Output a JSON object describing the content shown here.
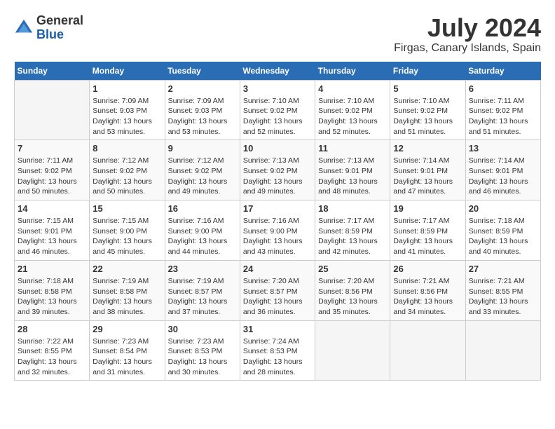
{
  "header": {
    "logo": {
      "general": "General",
      "blue": "Blue"
    },
    "title": "July 2024",
    "location": "Firgas, Canary Islands, Spain"
  },
  "calendar": {
    "days_of_week": [
      "Sunday",
      "Monday",
      "Tuesday",
      "Wednesday",
      "Thursday",
      "Friday",
      "Saturday"
    ],
    "weeks": [
      [
        {
          "day": "",
          "sunrise": "",
          "sunset": "",
          "daylight": ""
        },
        {
          "day": "1",
          "sunrise": "Sunrise: 7:09 AM",
          "sunset": "Sunset: 9:03 PM",
          "daylight": "Daylight: 13 hours and 53 minutes."
        },
        {
          "day": "2",
          "sunrise": "Sunrise: 7:09 AM",
          "sunset": "Sunset: 9:03 PM",
          "daylight": "Daylight: 13 hours and 53 minutes."
        },
        {
          "day": "3",
          "sunrise": "Sunrise: 7:10 AM",
          "sunset": "Sunset: 9:02 PM",
          "daylight": "Daylight: 13 hours and 52 minutes."
        },
        {
          "day": "4",
          "sunrise": "Sunrise: 7:10 AM",
          "sunset": "Sunset: 9:02 PM",
          "daylight": "Daylight: 13 hours and 52 minutes."
        },
        {
          "day": "5",
          "sunrise": "Sunrise: 7:10 AM",
          "sunset": "Sunset: 9:02 PM",
          "daylight": "Daylight: 13 hours and 51 minutes."
        },
        {
          "day": "6",
          "sunrise": "Sunrise: 7:11 AM",
          "sunset": "Sunset: 9:02 PM",
          "daylight": "Daylight: 13 hours and 51 minutes."
        }
      ],
      [
        {
          "day": "7",
          "sunrise": "Sunrise: 7:11 AM",
          "sunset": "Sunset: 9:02 PM",
          "daylight": "Daylight: 13 hours and 50 minutes."
        },
        {
          "day": "8",
          "sunrise": "Sunrise: 7:12 AM",
          "sunset": "Sunset: 9:02 PM",
          "daylight": "Daylight: 13 hours and 50 minutes."
        },
        {
          "day": "9",
          "sunrise": "Sunrise: 7:12 AM",
          "sunset": "Sunset: 9:02 PM",
          "daylight": "Daylight: 13 hours and 49 minutes."
        },
        {
          "day": "10",
          "sunrise": "Sunrise: 7:13 AM",
          "sunset": "Sunset: 9:02 PM",
          "daylight": "Daylight: 13 hours and 49 minutes."
        },
        {
          "day": "11",
          "sunrise": "Sunrise: 7:13 AM",
          "sunset": "Sunset: 9:01 PM",
          "daylight": "Daylight: 13 hours and 48 minutes."
        },
        {
          "day": "12",
          "sunrise": "Sunrise: 7:14 AM",
          "sunset": "Sunset: 9:01 PM",
          "daylight": "Daylight: 13 hours and 47 minutes."
        },
        {
          "day": "13",
          "sunrise": "Sunrise: 7:14 AM",
          "sunset": "Sunset: 9:01 PM",
          "daylight": "Daylight: 13 hours and 46 minutes."
        }
      ],
      [
        {
          "day": "14",
          "sunrise": "Sunrise: 7:15 AM",
          "sunset": "Sunset: 9:01 PM",
          "daylight": "Daylight: 13 hours and 46 minutes."
        },
        {
          "day": "15",
          "sunrise": "Sunrise: 7:15 AM",
          "sunset": "Sunset: 9:00 PM",
          "daylight": "Daylight: 13 hours and 45 minutes."
        },
        {
          "day": "16",
          "sunrise": "Sunrise: 7:16 AM",
          "sunset": "Sunset: 9:00 PM",
          "daylight": "Daylight: 13 hours and 44 minutes."
        },
        {
          "day": "17",
          "sunrise": "Sunrise: 7:16 AM",
          "sunset": "Sunset: 9:00 PM",
          "daylight": "Daylight: 13 hours and 43 minutes."
        },
        {
          "day": "18",
          "sunrise": "Sunrise: 7:17 AM",
          "sunset": "Sunset: 8:59 PM",
          "daylight": "Daylight: 13 hours and 42 minutes."
        },
        {
          "day": "19",
          "sunrise": "Sunrise: 7:17 AM",
          "sunset": "Sunset: 8:59 PM",
          "daylight": "Daylight: 13 hours and 41 minutes."
        },
        {
          "day": "20",
          "sunrise": "Sunrise: 7:18 AM",
          "sunset": "Sunset: 8:59 PM",
          "daylight": "Daylight: 13 hours and 40 minutes."
        }
      ],
      [
        {
          "day": "21",
          "sunrise": "Sunrise: 7:18 AM",
          "sunset": "Sunset: 8:58 PM",
          "daylight": "Daylight: 13 hours and 39 minutes."
        },
        {
          "day": "22",
          "sunrise": "Sunrise: 7:19 AM",
          "sunset": "Sunset: 8:58 PM",
          "daylight": "Daylight: 13 hours and 38 minutes."
        },
        {
          "day": "23",
          "sunrise": "Sunrise: 7:19 AM",
          "sunset": "Sunset: 8:57 PM",
          "daylight": "Daylight: 13 hours and 37 minutes."
        },
        {
          "day": "24",
          "sunrise": "Sunrise: 7:20 AM",
          "sunset": "Sunset: 8:57 PM",
          "daylight": "Daylight: 13 hours and 36 minutes."
        },
        {
          "day": "25",
          "sunrise": "Sunrise: 7:20 AM",
          "sunset": "Sunset: 8:56 PM",
          "daylight": "Daylight: 13 hours and 35 minutes."
        },
        {
          "day": "26",
          "sunrise": "Sunrise: 7:21 AM",
          "sunset": "Sunset: 8:56 PM",
          "daylight": "Daylight: 13 hours and 34 minutes."
        },
        {
          "day": "27",
          "sunrise": "Sunrise: 7:21 AM",
          "sunset": "Sunset: 8:55 PM",
          "daylight": "Daylight: 13 hours and 33 minutes."
        }
      ],
      [
        {
          "day": "28",
          "sunrise": "Sunrise: 7:22 AM",
          "sunset": "Sunset: 8:55 PM",
          "daylight": "Daylight: 13 hours and 32 minutes."
        },
        {
          "day": "29",
          "sunrise": "Sunrise: 7:23 AM",
          "sunset": "Sunset: 8:54 PM",
          "daylight": "Daylight: 13 hours and 31 minutes."
        },
        {
          "day": "30",
          "sunrise": "Sunrise: 7:23 AM",
          "sunset": "Sunset: 8:53 PM",
          "daylight": "Daylight: 13 hours and 30 minutes."
        },
        {
          "day": "31",
          "sunrise": "Sunrise: 7:24 AM",
          "sunset": "Sunset: 8:53 PM",
          "daylight": "Daylight: 13 hours and 28 minutes."
        },
        {
          "day": "",
          "sunrise": "",
          "sunset": "",
          "daylight": ""
        },
        {
          "day": "",
          "sunrise": "",
          "sunset": "",
          "daylight": ""
        },
        {
          "day": "",
          "sunrise": "",
          "sunset": "",
          "daylight": ""
        }
      ]
    ]
  }
}
